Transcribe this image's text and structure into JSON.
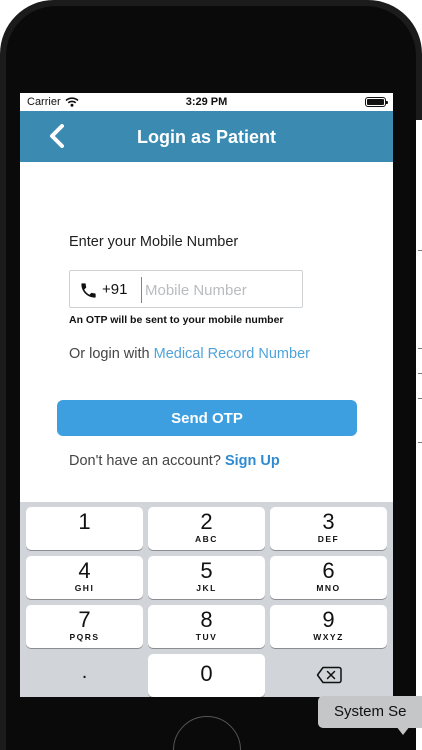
{
  "status_bar": {
    "carrier": "Carrier",
    "time": "3:29 PM"
  },
  "nav": {
    "title": "Login as Patient",
    "back_icon": "chevron-left-icon"
  },
  "form": {
    "label": "Enter your Mobile Number",
    "country_code": "+91",
    "mobile_placeholder": "Mobile Number",
    "mobile_value": "",
    "otp_hint": "An OTP will be sent to your mobile number",
    "alt_login_prefix": "Or login with ",
    "alt_login_link": "Medical Record Number",
    "send_button": "Send OTP",
    "signup_prefix": "Don't have an account? ",
    "signup_link": "Sign Up"
  },
  "keyboard": {
    "keys": [
      {
        "num": "1",
        "letters": ""
      },
      {
        "num": "2",
        "letters": "ABC"
      },
      {
        "num": "3",
        "letters": "DEF"
      },
      {
        "num": "4",
        "letters": "GHI"
      },
      {
        "num": "5",
        "letters": "JKL"
      },
      {
        "num": "6",
        "letters": "MNO"
      },
      {
        "num": "7",
        "letters": "PQRS"
      },
      {
        "num": "8",
        "letters": "TUV"
      },
      {
        "num": "9",
        "letters": "WXYZ"
      },
      {
        "num": ".",
        "letters": ""
      },
      {
        "num": "0",
        "letters": ""
      },
      {
        "num": "",
        "letters": ""
      }
    ]
  },
  "tooltip": {
    "text": "System Se"
  },
  "colors": {
    "nav": "#3a8ab2",
    "primary_button": "#3e9fe0",
    "link": "#4fa3db",
    "keyboard_bg": "#d1d4d9"
  }
}
